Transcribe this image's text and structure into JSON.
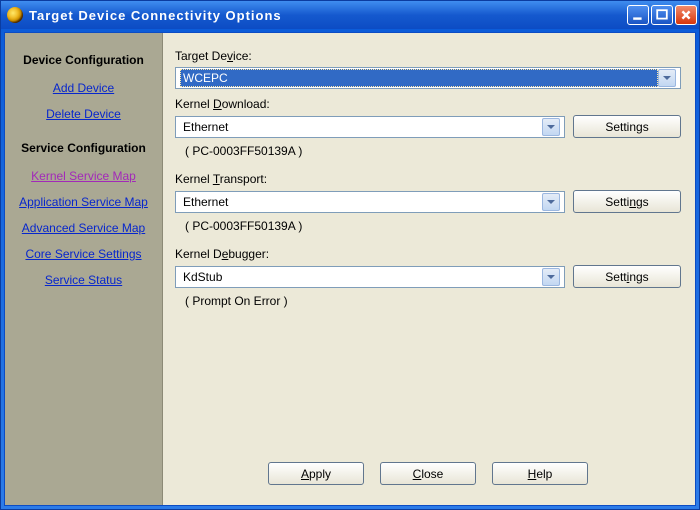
{
  "window": {
    "title": "Target Device Connectivity Options"
  },
  "sidebar": {
    "section1_heading": "Device Configuration",
    "add_device": "Add Device",
    "delete_device": "Delete Device",
    "section2_heading": "Service Configuration",
    "kernel_service_map": "Kernel Service Map",
    "application_service_map": "Application Service Map",
    "advanced_service_map": "Advanced Service Map",
    "core_service_settings": "Core Service Settings",
    "service_status": "Service Status"
  },
  "form": {
    "target_device_label_pre": "Target De",
    "target_device_label_u": "v",
    "target_device_label_post": "ice:",
    "target_device_value": "WCEPC",
    "kernel_download_label_pre": "Kernel ",
    "kernel_download_label_u": "D",
    "kernel_download_label_post": "ownload:",
    "kernel_download_value": "Ethernet",
    "kernel_download_sub": "( PC-0003FF50139A )",
    "kernel_transport_label_pre": "Kernel ",
    "kernel_transport_label_u": "T",
    "kernel_transport_label_post": "ransport:",
    "kernel_transport_value": "Ethernet",
    "kernel_transport_sub": "( PC-0003FF50139A )",
    "kernel_debugger_label_pre": "Kernel D",
    "kernel_debugger_label_u": "e",
    "kernel_debugger_label_post": "bugger:",
    "kernel_debugger_value": "KdStub",
    "kernel_debugger_sub": "( Prompt On Error )",
    "settings_pre": "Settin",
    "settings_u": "g",
    "settings_post": "s",
    "settings2_pre": "Setti",
    "settings2_u": "n",
    "settings2_post": "gs",
    "settings3_pre": "Sett",
    "settings3_u": "i",
    "settings3_post": "ngs"
  },
  "buttons": {
    "apply_u": "A",
    "apply_post": "pply",
    "close_u": "C",
    "close_post": "lose",
    "help_u": "H",
    "help_post": "elp"
  }
}
